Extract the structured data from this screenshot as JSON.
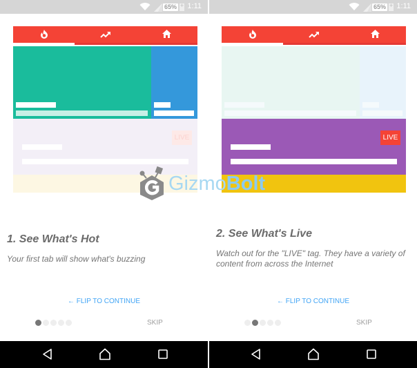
{
  "status_bar": {
    "battery": "65%",
    "time": "1:11",
    "icons": [
      "wifi-icon",
      "signal-icon",
      "battery-icon"
    ]
  },
  "tabs": [
    {
      "icon": "flame-icon",
      "label": "Hot"
    },
    {
      "icon": "trending-icon",
      "label": "Trending"
    },
    {
      "icon": "home-icon",
      "label": "Home"
    }
  ],
  "colors": {
    "tab_bar": "#f44336",
    "hero": "#1abc9c",
    "side": "#3498db",
    "live_card": "#9b59b6",
    "bottom_card": "#f1c40f",
    "live_tag": "#f44336",
    "link": "#42a5f5"
  },
  "screens": [
    {
      "live_tag": "LIVE",
      "title": "1. See What's Hot",
      "description": "Your first tab will show what's buzzing",
      "flip_label": "← FLIP TO CONTINUE",
      "skip_label": "SKIP",
      "page_index": 1,
      "page_count": 5
    },
    {
      "live_tag": "LIVE",
      "title": "2. See What's Live",
      "description": "Watch out for the \"LIVE\" tag. They have a variety of content from across the Internet",
      "flip_label": "← FLIP TO CONTINUE",
      "skip_label": "SKIP",
      "page_index": 2,
      "page_count": 5
    }
  ],
  "nav_bar": {
    "back": "back-icon",
    "home": "home-nav-icon",
    "recents": "recents-icon"
  },
  "watermark": {
    "text_light": "Gizmo",
    "text_bold": "Bolt"
  }
}
